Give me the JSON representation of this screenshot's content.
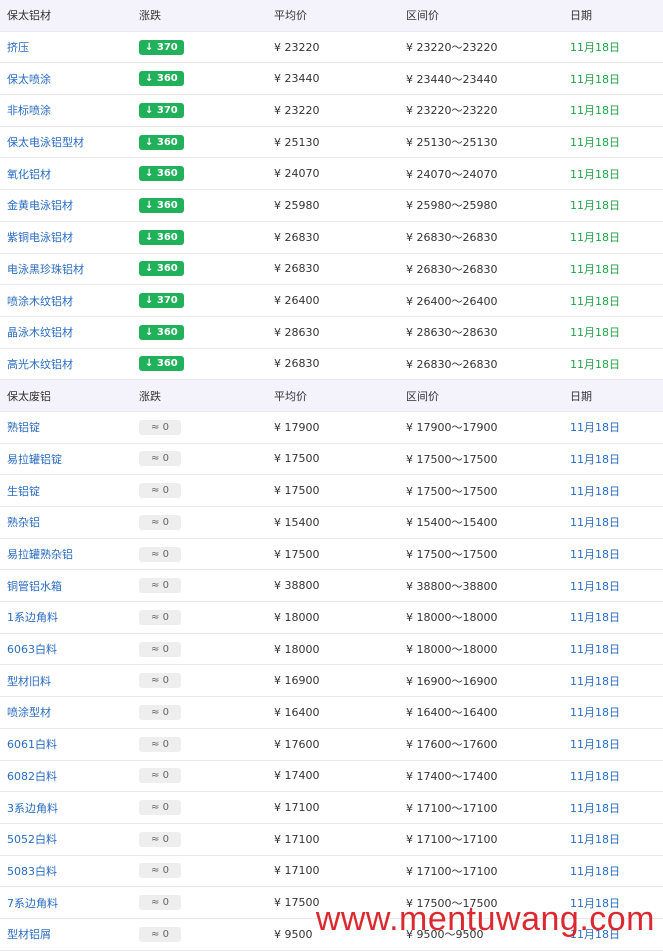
{
  "section1": {
    "headers": [
      "保太铝材",
      "涨跌",
      "平均价",
      "区间价",
      "日期"
    ],
    "rows": [
      {
        "name": "挤压",
        "change": "↓ 370",
        "avg": "¥ 23220",
        "range": "¥ 23220～23220",
        "date": "11月18日"
      },
      {
        "name": "保太喷涂",
        "change": "↓ 360",
        "avg": "¥ 23440",
        "range": "¥ 23440～23440",
        "date": "11月18日"
      },
      {
        "name": "非标喷涂",
        "change": "↓ 370",
        "avg": "¥ 23220",
        "range": "¥ 23220～23220",
        "date": "11月18日"
      },
      {
        "name": "保太电泳铝型材",
        "change": "↓ 360",
        "avg": "¥ 25130",
        "range": "¥ 25130～25130",
        "date": "11月18日"
      },
      {
        "name": "氧化铝材",
        "change": "↓ 360",
        "avg": "¥ 24070",
        "range": "¥ 24070～24070",
        "date": "11月18日"
      },
      {
        "name": "金黄电泳铝材",
        "change": "↓ 360",
        "avg": "¥ 25980",
        "range": "¥ 25980～25980",
        "date": "11月18日"
      },
      {
        "name": "紫铜电泳铝材",
        "change": "↓ 360",
        "avg": "¥ 26830",
        "range": "¥ 26830～26830",
        "date": "11月18日"
      },
      {
        "name": "电泳黑珍珠铝材",
        "change": "↓ 360",
        "avg": "¥ 26830",
        "range": "¥ 26830～26830",
        "date": "11月18日"
      },
      {
        "name": "喷涂木纹铝材",
        "change": "↓ 370",
        "avg": "¥ 26400",
        "range": "¥ 26400～26400",
        "date": "11月18日"
      },
      {
        "name": "晶泳木纹铝材",
        "change": "↓ 360",
        "avg": "¥ 28630",
        "range": "¥ 28630～28630",
        "date": "11月18日"
      },
      {
        "name": "高光木纹铝材",
        "change": "↓ 360",
        "avg": "¥ 26830",
        "range": "¥ 26830～26830",
        "date": "11月18日"
      }
    ]
  },
  "section2": {
    "headers": [
      "保太废铝",
      "涨跌",
      "平均价",
      "区间价",
      "日期"
    ],
    "rows": [
      {
        "name": "熟铝锭",
        "change": "≈ 0",
        "avg": "¥ 17900",
        "range": "¥ 17900～17900",
        "date": "11月18日"
      },
      {
        "name": "易拉罐铝锭",
        "change": "≈ 0",
        "avg": "¥ 17500",
        "range": "¥ 17500～17500",
        "date": "11月18日"
      },
      {
        "name": "生铝锭",
        "change": "≈ 0",
        "avg": "¥ 17500",
        "range": "¥ 17500～17500",
        "date": "11月18日"
      },
      {
        "name": "熟杂铝",
        "change": "≈ 0",
        "avg": "¥ 15400",
        "range": "¥ 15400～15400",
        "date": "11月18日"
      },
      {
        "name": "易拉罐熟杂铝",
        "change": "≈ 0",
        "avg": "¥ 17500",
        "range": "¥ 17500～17500",
        "date": "11月18日"
      },
      {
        "name": "铜管铝水箱",
        "change": "≈ 0",
        "avg": "¥ 38800",
        "range": "¥ 38800～38800",
        "date": "11月18日"
      },
      {
        "name": "1系边角料",
        "change": "≈ 0",
        "avg": "¥ 18000",
        "range": "¥ 18000～18000",
        "date": "11月18日"
      },
      {
        "name": "6063白料",
        "change": "≈ 0",
        "avg": "¥ 18000",
        "range": "¥ 18000～18000",
        "date": "11月18日"
      },
      {
        "name": "型材旧料",
        "change": "≈ 0",
        "avg": "¥ 16900",
        "range": "¥ 16900～16900",
        "date": "11月18日"
      },
      {
        "name": "喷涂型材",
        "change": "≈ 0",
        "avg": "¥ 16400",
        "range": "¥ 16400～16400",
        "date": "11月18日"
      },
      {
        "name": "6061白料",
        "change": "≈ 0",
        "avg": "¥ 17600",
        "range": "¥ 17600～17600",
        "date": "11月18日"
      },
      {
        "name": "6082白料",
        "change": "≈ 0",
        "avg": "¥ 17400",
        "range": "¥ 17400～17400",
        "date": "11月18日"
      },
      {
        "name": "3系边角料",
        "change": "≈ 0",
        "avg": "¥ 17100",
        "range": "¥ 17100～17100",
        "date": "11月18日"
      },
      {
        "name": "5052白料",
        "change": "≈ 0",
        "avg": "¥ 17100",
        "range": "¥ 17100～17100",
        "date": "11月18日"
      },
      {
        "name": "5083白料",
        "change": "≈ 0",
        "avg": "¥ 17100",
        "range": "¥ 17100～17100",
        "date": "11月18日"
      },
      {
        "name": "7系边角料",
        "change": "≈ 0",
        "avg": "¥ 17500",
        "range": "¥ 17500～17500",
        "date": "11月18日"
      },
      {
        "name": "型材铝屑",
        "change": "≈ 0",
        "avg": "¥ 9500",
        "range": "¥ 9500～9500",
        "date": "11月18日"
      }
    ]
  },
  "watermark": {
    "url": "www.mentuwang.com"
  },
  "colors": {
    "down_badge": "#21b15a",
    "date_green": "#21a04a",
    "link_blue": "#2a6cc0",
    "header_bg": "#f4f2fb",
    "watermark_red": "#d8181e"
  }
}
